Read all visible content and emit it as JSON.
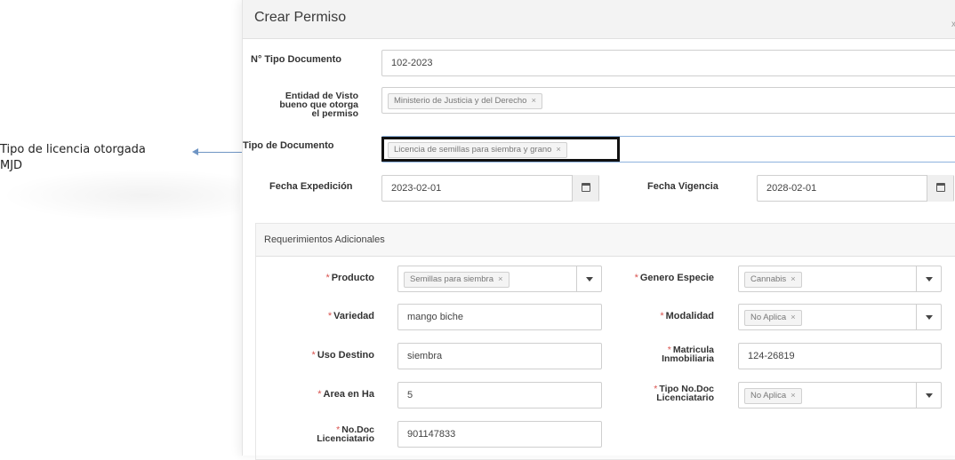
{
  "annotation": {
    "line1": "Tipo de licencia otorgada",
    "line2": "MJD"
  },
  "modal": {
    "title": "Crear Permiso",
    "close": "x"
  },
  "form": {
    "tipo_documento_num": {
      "label": "N° Tipo Documento",
      "value": "102-2023"
    },
    "entidad": {
      "label_l1": "Entidad de Visto",
      "label_l2": "bueno que otorga",
      "label_l3": "el permiso",
      "tag": "Ministerio de Justicia y del Derecho"
    },
    "tipo_documento": {
      "label": "Tipo de Documento",
      "tag": "Licencia de semillas para siembra y grano"
    },
    "fecha_expedicion": {
      "label": "Fecha Expedición",
      "value": "2023-02-01"
    },
    "fecha_vigencia": {
      "label": "Fecha Vigencia",
      "value": "2028-02-01"
    }
  },
  "requerimientos": {
    "title": "Requerimientos Adicionales",
    "required_mark": "*",
    "tag_remove": "×",
    "producto": {
      "label": "Producto",
      "tag": "Semillas para siembra"
    },
    "genero_especie": {
      "label": "Genero Especie",
      "tag": "Cannabis"
    },
    "variedad": {
      "label": "Variedad",
      "value": "mango biche"
    },
    "modalidad": {
      "label": "Modalidad",
      "tag": "No Aplica"
    },
    "uso_destino": {
      "label": "Uso Destino",
      "value": "siembra"
    },
    "matricula": {
      "label_l1": "Matricula",
      "label_l2": "Inmobiliaria",
      "value": "124-26819"
    },
    "area": {
      "label": "Area en Ha",
      "value": "5"
    },
    "tipo_no_doc": {
      "label_l1": "Tipo No.Doc",
      "label_l2": "Licenciatario",
      "tag": "No Aplica"
    },
    "no_doc": {
      "label_l1": "No.Doc",
      "label_l2": "Licenciatario",
      "value": "901147833"
    }
  },
  "colors": {
    "arrow": "#6f95c4",
    "required": "#d9534f",
    "highlight_border": "#111111"
  },
  "icons": {
    "calendar": "calendar-icon",
    "dropdown": "chevron-down-icon",
    "close": "close-icon"
  }
}
